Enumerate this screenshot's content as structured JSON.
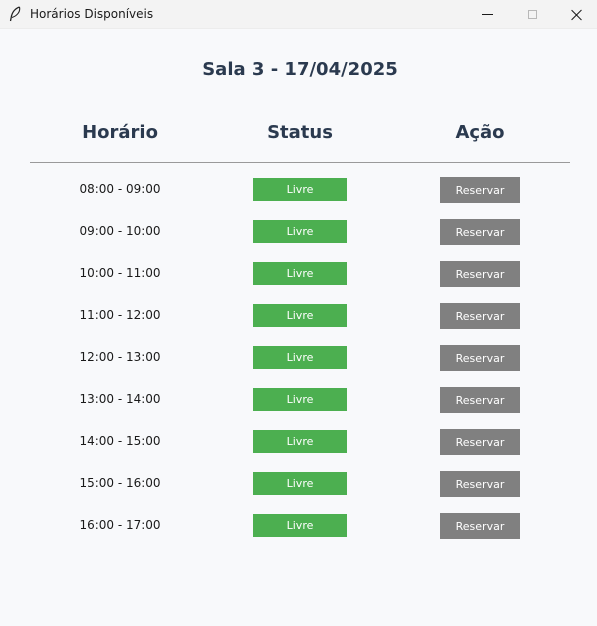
{
  "window": {
    "title": "Horários Disponíveis",
    "icon": "feather-icon"
  },
  "page": {
    "title": "Sala 3 - 17/04/2025"
  },
  "table": {
    "headers": [
      "Horário",
      "Status",
      "Ação"
    ],
    "rows": [
      {
        "time": "08:00 - 09:00",
        "status": "Livre",
        "action": "Reservar"
      },
      {
        "time": "09:00 - 10:00",
        "status": "Livre",
        "action": "Reservar"
      },
      {
        "time": "10:00 - 11:00",
        "status": "Livre",
        "action": "Reservar"
      },
      {
        "time": "11:00 - 12:00",
        "status": "Livre",
        "action": "Reservar"
      },
      {
        "time": "12:00 - 13:00",
        "status": "Livre",
        "action": "Reservar"
      },
      {
        "time": "13:00 - 14:00",
        "status": "Livre",
        "action": "Reservar"
      },
      {
        "time": "14:00 - 15:00",
        "status": "Livre",
        "action": "Reservar"
      },
      {
        "time": "15:00 - 16:00",
        "status": "Livre",
        "action": "Reservar"
      },
      {
        "time": "16:00 - 17:00",
        "status": "Livre",
        "action": "Reservar"
      }
    ]
  },
  "colors": {
    "status_free": "#4caf50",
    "action_button": "#808080",
    "heading": "#2b3a4f",
    "background": "#f8f9fb"
  }
}
